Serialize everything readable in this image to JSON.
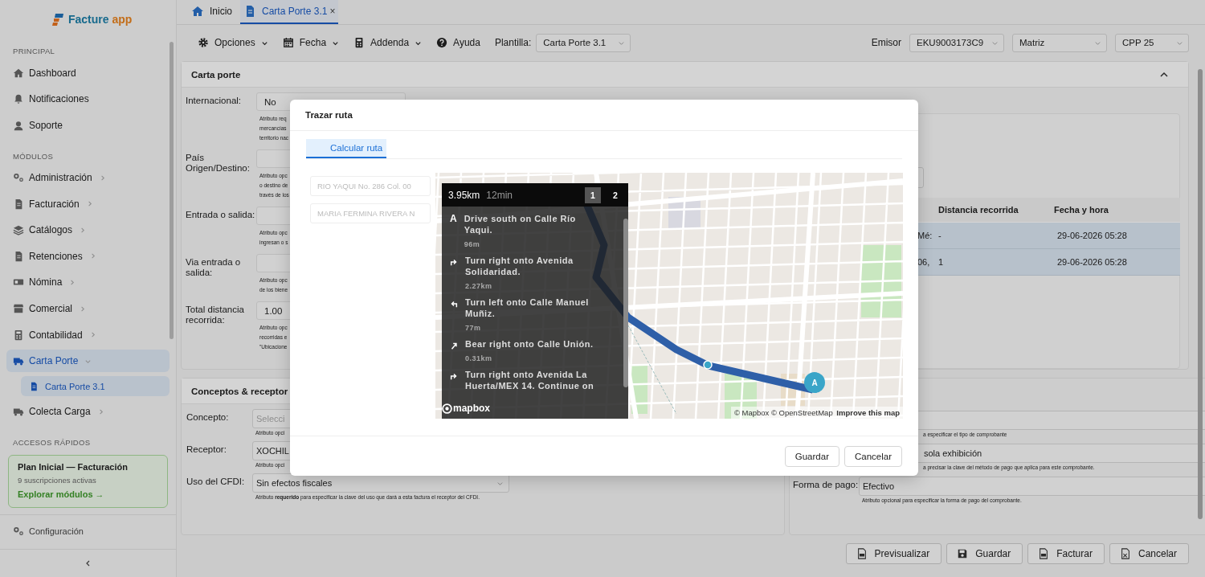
{
  "sidebar": {
    "logo": {
      "name": "Facture",
      "suffix": "app"
    },
    "sections": [
      {
        "title": "PRINCIPAL",
        "items": [
          {
            "label": "Dashboard",
            "selected": false
          },
          {
            "label": "Notificaciones",
            "selected": false
          },
          {
            "label": "Soporte",
            "selected": false
          }
        ]
      },
      {
        "title": "MÓDULOS",
        "items": [
          {
            "label": "Administración",
            "selected": false,
            "expanded": false
          },
          {
            "label": "Facturación",
            "selected": false,
            "expanded": false
          },
          {
            "label": "Catálogos",
            "selected": false,
            "expanded": false
          },
          {
            "label": "Retenciones",
            "selected": false,
            "expanded": false
          },
          {
            "label": "Nómina",
            "selected": false,
            "expanded": false
          },
          {
            "label": "Comercial",
            "selected": false,
            "expanded": false
          },
          {
            "label": "Contabilidad",
            "selected": false,
            "expanded": false
          },
          {
            "label": "Carta Porte",
            "selected": true,
            "expanded": true,
            "children": [
              {
                "label": "Carta Porte 3.1",
                "selected": true
              }
            ]
          },
          {
            "label": "Colecta Carga",
            "selected": false,
            "expanded": false
          }
        ]
      },
      {
        "title": "ACCESOS RÁPIDOS",
        "card": {
          "title": "Plan Inicial — Facturación",
          "subtitle": "9 suscripciones activas",
          "link": "Explorar módulos →"
        }
      }
    ],
    "footer_item": {
      "label": "Configuración"
    }
  },
  "tabs": [
    {
      "label": "Inicio",
      "selected": false,
      "closable": false
    },
    {
      "label": "Carta Porte 3.1",
      "selected": true,
      "closable": true,
      "close": "×"
    }
  ],
  "toolbar": {
    "menus": [
      {
        "label": "Opciones",
        "dropdown": true
      },
      {
        "label": "Fecha",
        "dropdown": true
      },
      {
        "label": "Addenda",
        "dropdown": true
      },
      {
        "label": "Ayuda",
        "dropdown": false
      }
    ],
    "template": {
      "label": "Plantilla:",
      "value": "Carta Porte 3.1"
    },
    "emisor": {
      "label": "Emisor",
      "value": "EKU9003173C9"
    },
    "selects": [
      {
        "value": "Matriz"
      },
      {
        "value": "CPP 25"
      }
    ]
  },
  "carta_porte": {
    "title": "Carta porte",
    "expanded": true,
    "fields": [
      {
        "label": "Internacional:",
        "value": "No",
        "help": [
          "Atributo req",
          "mercancías",
          "territorio nac"
        ]
      },
      {
        "label": "País Origen/Destino:",
        "help": [
          "Atributo opc",
          "o destino de",
          "través de los"
        ]
      },
      {
        "label": "Entrada o salida:",
        "help": [
          "Atributo opc",
          "ingresan o s"
        ]
      },
      {
        "label": "Via entrada o salida:",
        "help": [
          "Atributo opc",
          "de los biene"
        ]
      },
      {
        "label": "Total distancia recorrida:",
        "value": "1.00",
        "help": [
          "Atributo opc",
          "recorridas e",
          "\"Ubicacione"
        ]
      }
    ],
    "table": {
      "columns": [
        "",
        "Distancia recorrida",
        "Fecha y hora"
      ],
      "rows": [
        {
          "cells": [
            "Mé:",
            "-",
            "29-06-2026 05:28"
          ],
          "selected": true
        },
        {
          "cells": [
            "06,",
            "1",
            "29-06-2026 05:28"
          ],
          "selected": true
        }
      ]
    }
  },
  "conceptos": {
    "title": "Conceptos & receptor",
    "fields": [
      {
        "label": "Concepto:",
        "kind": "select",
        "placeholder": "Selecci",
        "help": "Atributo opci"
      },
      {
        "label": "Receptor:",
        "kind": "input",
        "value": "XOCHIL",
        "help": "Atributo opci"
      },
      {
        "label": "Uso del CFDI:",
        "kind": "select",
        "value": "Sin efectos fiscales",
        "help": "Atributo **requerido** para especificar la clave del uso que dará a esta factura el receptor del CFDI."
      }
    ]
  },
  "comprobante": {
    "fields": [
      {
        "kind": "select",
        "help": "a especificar el tipo de comprobante"
      },
      {
        "kind": "select",
        "value": "sola exhibición",
        "help": "a precisar la clave del método de pago que aplica para este comprobante."
      },
      {
        "kind": "select",
        "label": "Forma de pago:",
        "value": "Efectivo",
        "help": "Atributo opcional para especificar la forma de pago del comprobante."
      }
    ]
  },
  "actions": [
    {
      "label": "Previsualizar"
    },
    {
      "label": "Guardar"
    },
    {
      "label": "Facturar"
    },
    {
      "label": "Cancelar"
    }
  ],
  "dialog": {
    "title": "Trazar ruta",
    "tabs": [
      {
        "label": "Calcular ruta",
        "selected": true
      }
    ],
    "inputs": [
      {
        "value": "RIO YAQUI No. 286 Col. 00",
        "disabled": true
      },
      {
        "value": "MARIA FERMINA RIVERA N",
        "disabled": true
      }
    ],
    "directions": {
      "distance": "3.95km",
      "duration": "12min",
      "routes": [
        {
          "label": "1",
          "selected": true
        },
        {
          "label": "2",
          "selected": false
        }
      ],
      "steps": [
        {
          "kind": "depart",
          "marker": "A",
          "text": "Drive south on Calle Río Yaqui.",
          "distance": "96m"
        },
        {
          "kind": "right",
          "text": "Turn right onto Avenida Solidaridad.",
          "distance": "2.27km"
        },
        {
          "kind": "left",
          "text": "Turn left onto Calle Manuel Muñiz.",
          "distance": "77m"
        },
        {
          "kind": "bear_right",
          "text": "Bear right onto Calle Unión.",
          "distance": "0.31km"
        },
        {
          "kind": "right",
          "text": "Turn right onto Avenida La Huerta/MEX 14. Continue on"
        }
      ]
    },
    "map": {
      "logo": "mapbox",
      "marker": "A",
      "attribution": "© Mapbox © OpenStreetMap",
      "improve_link": "Improve this map"
    },
    "buttons": [
      {
        "label": "Guardar"
      },
      {
        "label": "Cancelar"
      }
    ]
  }
}
